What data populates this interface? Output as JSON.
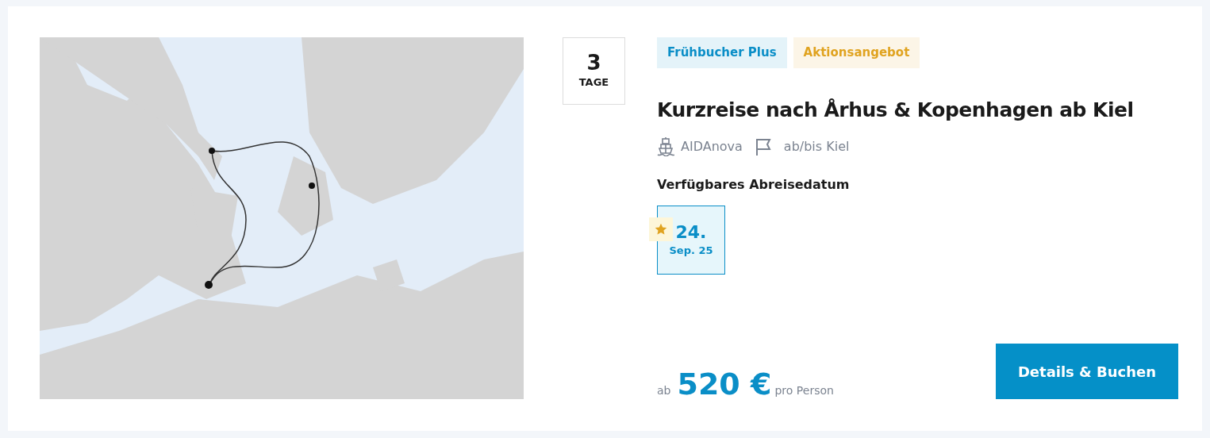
{
  "trip": {
    "duration": {
      "number": "3",
      "unit": "TAGE"
    },
    "badges": [
      {
        "label": "Frühbucher Plus",
        "color": "#0a8ec7"
      },
      {
        "label": "Aktionsangebot",
        "color": "#e0a320"
      }
    ],
    "title": "Kurzreise nach Århus & Kopenhagen ab Kiel",
    "ship": "AIDAnova",
    "port": "ab/bis Kiel",
    "dates_heading": "Verfügbares Abreisedatum",
    "dates": [
      {
        "day": "24.",
        "month": "Sep. 25",
        "selected": true,
        "featured": true
      }
    ],
    "price": {
      "prefix": "ab",
      "amount": "520 €",
      "suffix": "pro Person"
    },
    "button": "Details & Buchen"
  }
}
